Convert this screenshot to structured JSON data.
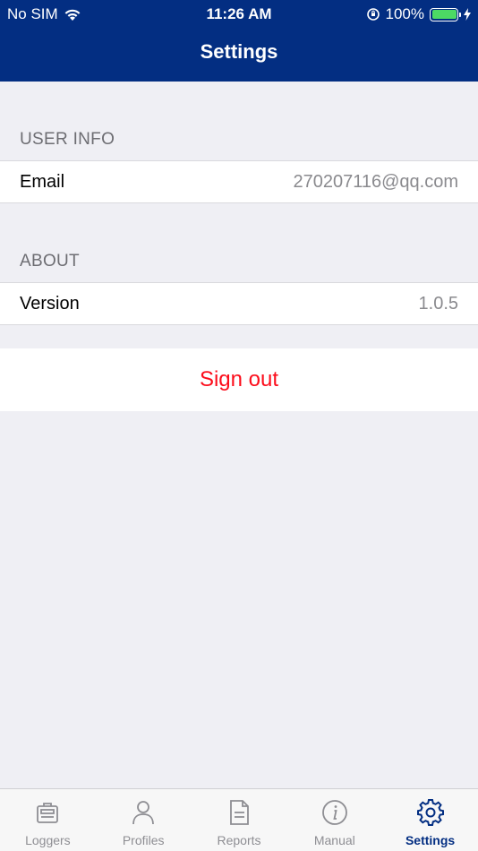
{
  "status_bar": {
    "carrier": "No SIM",
    "time": "11:26 AM",
    "battery": "100%",
    "battery_level": 1.0
  },
  "nav": {
    "title": "Settings"
  },
  "sections": {
    "user_info": {
      "header": "USER INFO",
      "email_label": "Email",
      "email_value": "270207116@qq.com"
    },
    "about": {
      "header": "ABOUT",
      "version_label": "Version",
      "version_value": "1.0.5"
    }
  },
  "sign_out_label": "Sign out",
  "tabbar": {
    "items": [
      {
        "label": "Loggers",
        "icon": "logger-icon"
      },
      {
        "label": "Profiles",
        "icon": "person-icon"
      },
      {
        "label": "Reports",
        "icon": "document-icon"
      },
      {
        "label": "Manual",
        "icon": "info-icon"
      },
      {
        "label": "Settings",
        "icon": "gear-icon"
      }
    ],
    "active_index": 4
  },
  "colors": {
    "nav_background": "#032e82",
    "active_tab": "#032e82",
    "inactive_tab": "#8e8e93",
    "sign_out": "#fc0d1b",
    "battery_fill": "#4cd964"
  }
}
